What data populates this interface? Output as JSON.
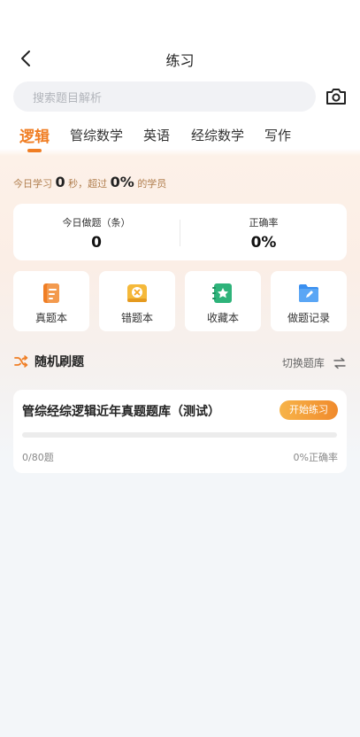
{
  "header": {
    "title": "练习",
    "back_icon": "chevron-left-icon"
  },
  "search": {
    "placeholder": "搜索题目解析",
    "camera_icon": "camera-icon"
  },
  "tabs": [
    {
      "label": "逻辑",
      "active": true
    },
    {
      "label": "管综数学",
      "active": false
    },
    {
      "label": "英语",
      "active": false
    },
    {
      "label": "经综数学",
      "active": false
    },
    {
      "label": "写作",
      "active": false
    }
  ],
  "today": {
    "prefix": "今日学习",
    "seconds": "0",
    "middle": "秒，超过",
    "percent": "0%",
    "suffix": "的学员"
  },
  "stats": {
    "done_label": "今日做题（条）",
    "done_value": "0",
    "accuracy_label": "正确率",
    "accuracy_value": "0%"
  },
  "actions": [
    {
      "label": "真题本",
      "icon": "notebook-icon",
      "color": "#f07e24"
    },
    {
      "label": "错题本",
      "icon": "wrong-book-icon",
      "color": "#f5b93a"
    },
    {
      "label": "收藏本",
      "icon": "favorite-star-icon",
      "color": "#2eb37a"
    },
    {
      "label": "做题记录",
      "icon": "record-folder-icon",
      "color": "#3a8ff0"
    }
  ],
  "random": {
    "title": "随机刷题",
    "switch_label": "切换题库"
  },
  "bank": {
    "title": "管综经综逻辑近年真题题库（测试）",
    "start_label": "开始练习",
    "progress_text": "0/80题",
    "progress": 0,
    "accuracy_text": "0%正确率"
  },
  "colors": {
    "accent": "#f07e24",
    "card_bg": "#ffffff",
    "page_bg": "#f3f6f9"
  }
}
